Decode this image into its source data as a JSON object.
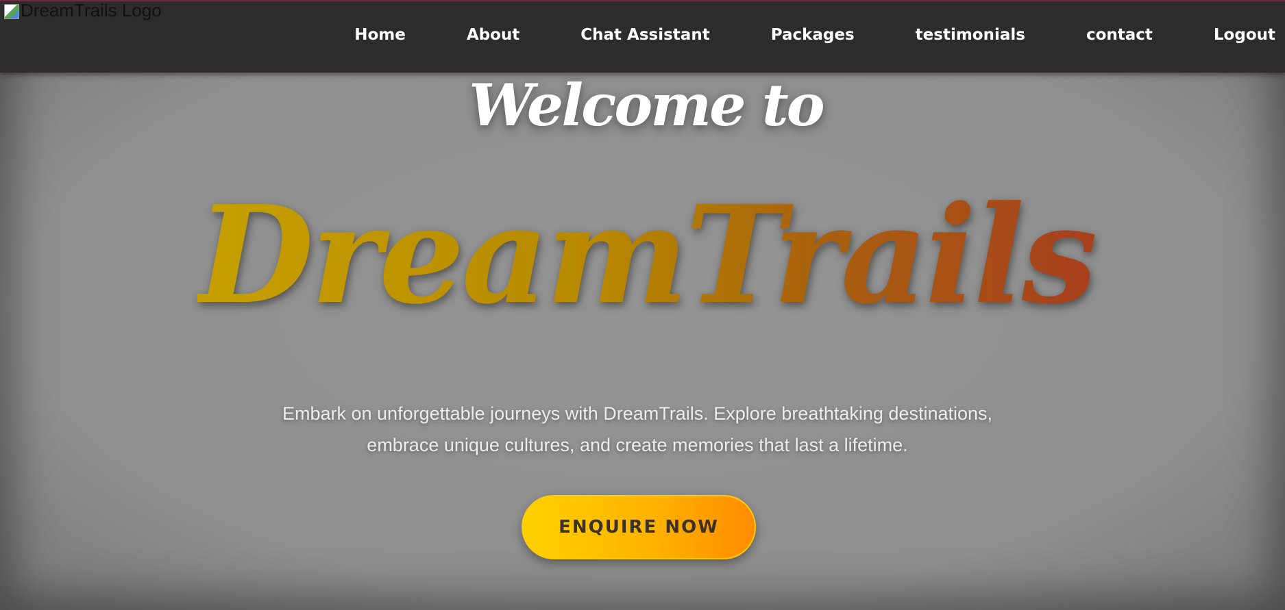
{
  "header": {
    "logo_alt": "DreamTrails Logo",
    "nav": [
      {
        "label": "Home"
      },
      {
        "label": "About"
      },
      {
        "label": "Chat Assistant"
      },
      {
        "label": "Packages"
      },
      {
        "label": "testimonials"
      },
      {
        "label": "contact"
      },
      {
        "label": "Logout"
      }
    ]
  },
  "hero": {
    "welcome": "Welcome to",
    "brand": "DreamTrails",
    "tagline": "Embark on unforgettable journeys with DreamTrails. Explore breathtaking destinations, embrace unique cultures, and create memories that last a lifetime.",
    "cta_label": "ENQUIRE NOW"
  },
  "colors": {
    "navbar_bg": "#2e2b2b",
    "hero_bg": "#8f8f8f",
    "brand_gradient_start": "#c6a000",
    "brand_gradient_end": "#a83f1d",
    "cta_gradient_start": "#ffd100",
    "cta_gradient_end": "#ff8c00"
  },
  "icons": {
    "logo": "broken-image-icon"
  }
}
